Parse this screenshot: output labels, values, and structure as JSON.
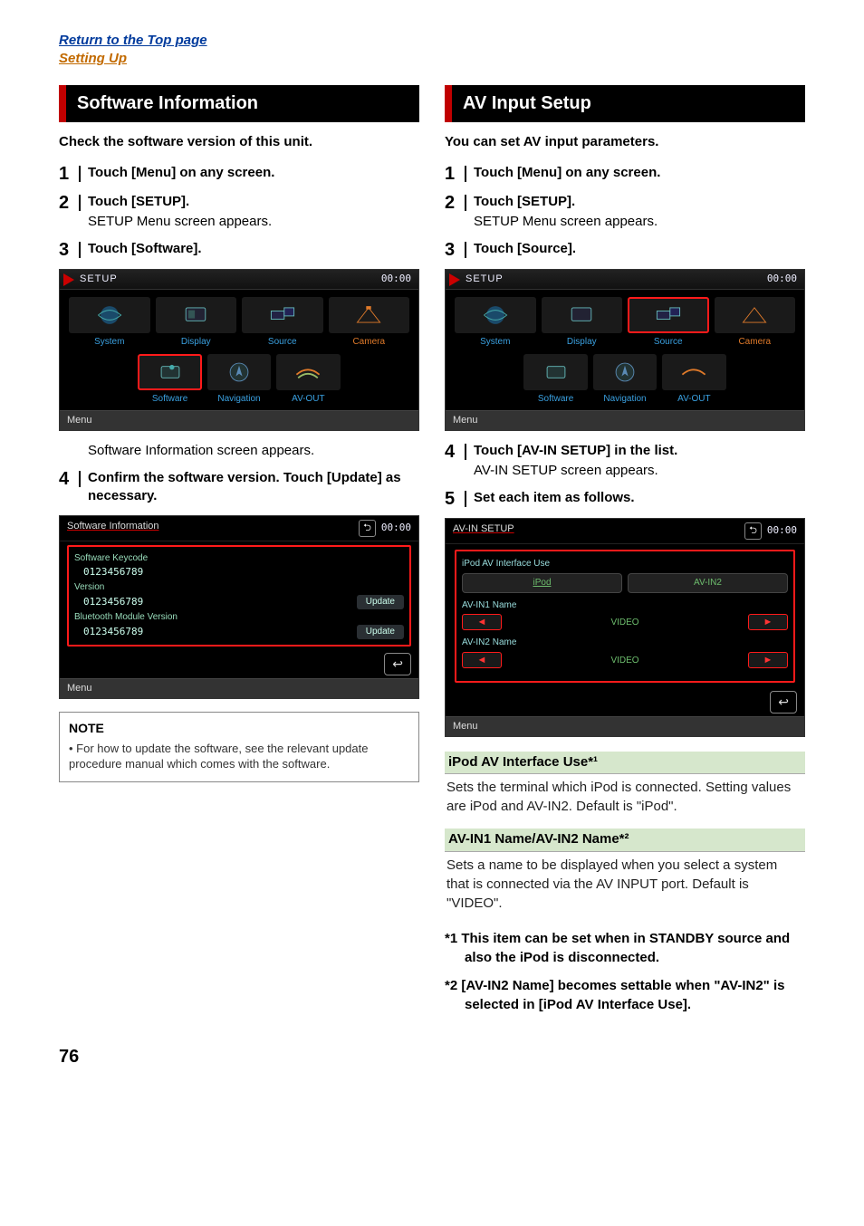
{
  "top": {
    "link1": "Return to the Top page",
    "link2": "Setting Up"
  },
  "left": {
    "header": "Software Information",
    "intro": "Check the software version of this unit.",
    "steps": [
      {
        "title": "Touch [Menu] on any screen."
      },
      {
        "title": "Touch [SETUP].",
        "desc": "SETUP Menu screen appears."
      },
      {
        "title": "Touch [Software]."
      }
    ],
    "setup_shot": {
      "title": "SETUP",
      "time": "00:00",
      "tiles_row1": [
        "System",
        "Display",
        "Source",
        "Camera"
      ],
      "tiles_row2": [
        "Software",
        "Navigation",
        "AV-OUT"
      ],
      "highlight_row2_index": 0,
      "menu": "Menu"
    },
    "after_shot_desc": "Software Information screen appears.",
    "step4_title": "Confirm the software version. Touch [Update] as necessary.",
    "soft_shot": {
      "title": "Software Information",
      "time": "00:00",
      "rows": [
        {
          "label": "Software Keycode",
          "value": "0123456789"
        },
        {
          "label": "Version",
          "value": "0123456789",
          "button": "Update"
        },
        {
          "label": "Bluetooth Module Version",
          "value": "0123456789",
          "button": "Update"
        }
      ],
      "menu": "Menu"
    },
    "note_title": "NOTE",
    "note_item": "For how to update the software, see the relevant update procedure manual which comes with the software."
  },
  "right": {
    "header": "AV Input Setup",
    "intro": "You can set AV input parameters.",
    "steps": [
      {
        "title": "Touch [Menu] on any screen."
      },
      {
        "title": "Touch [SETUP].",
        "desc": "SETUP Menu screen appears."
      },
      {
        "title": "Touch [Source]."
      }
    ],
    "setup_shot": {
      "title": "SETUP",
      "time": "00:00",
      "tiles_row1": [
        "System",
        "Display",
        "Source",
        "Camera"
      ],
      "tiles_row2": [
        "Software",
        "Navigation",
        "AV-OUT"
      ],
      "highlight_row1_index": 2,
      "menu": "Menu"
    },
    "step4_title": "Touch [AV-IN SETUP] in the list.",
    "step4_desc": "AV-IN SETUP screen appears.",
    "step5_title": "Set each item as follows.",
    "avin_shot": {
      "title": "AV-IN SETUP",
      "time": "00:00",
      "iface_label": "iPod AV Interface Use",
      "iface_opt1": "iPod",
      "iface_opt2": "AV-IN2",
      "name1_label": "AV-IN1 Name",
      "name1_value": "VIDEO",
      "name2_label": "AV-IN2 Name",
      "name2_value": "VIDEO",
      "menu": "Menu"
    },
    "opt1_head": "iPod AV Interface Use*¹",
    "opt1_body": "Sets the terminal which iPod is connected. Setting values are iPod and AV-IN2. Default is \"iPod\".",
    "opt2_head": "AV-IN1 Name/AV-IN2 Name*²",
    "opt2_body": "Sets a name to be displayed when you select a system that is connected via the AV INPUT port. Default is \"VIDEO\".",
    "foot1": "*1 This item can be set when in STANDBY source and also the iPod is disconnected.",
    "foot2": "*2 [AV-IN2 Name] becomes settable when \"AV-IN2\" is selected in [iPod AV Interface Use]."
  },
  "page_number": "76"
}
